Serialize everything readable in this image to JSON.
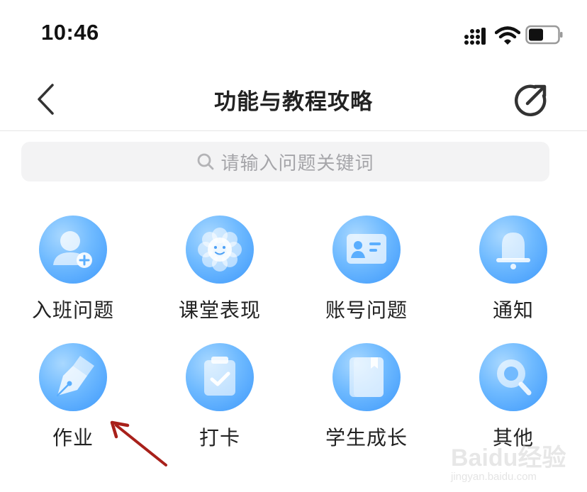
{
  "status_bar": {
    "time": "10:46",
    "icons": [
      "signal-icon",
      "wifi-icon",
      "battery-icon"
    ]
  },
  "header": {
    "title": "功能与教程攻略",
    "back_icon": "chevron-left-icon",
    "share_icon": "share-icon"
  },
  "search": {
    "placeholder": "请输入问题关键词",
    "icon": "search-icon"
  },
  "categories": [
    {
      "label": "入班问题",
      "icon": "user-add-icon"
    },
    {
      "label": "课堂表现",
      "icon": "flower-smile-icon"
    },
    {
      "label": "账号问题",
      "icon": "id-card-icon"
    },
    {
      "label": "通知",
      "icon": "bell-icon"
    },
    {
      "label": "作业",
      "icon": "pen-nib-icon"
    },
    {
      "label": "打卡",
      "icon": "clipboard-check-icon"
    },
    {
      "label": "学生成长",
      "icon": "book-icon"
    },
    {
      "label": "其他",
      "icon": "magnifier-icon"
    }
  ],
  "watermark": {
    "logo": "Baidu经验",
    "url": "jingyan.baidu.com"
  },
  "colors": {
    "icon_gradient_light": "#a9d8ff",
    "icon_gradient_dark": "#3d98fb",
    "annotation_arrow": "#a8201a",
    "search_bg": "#f3f3f4"
  }
}
